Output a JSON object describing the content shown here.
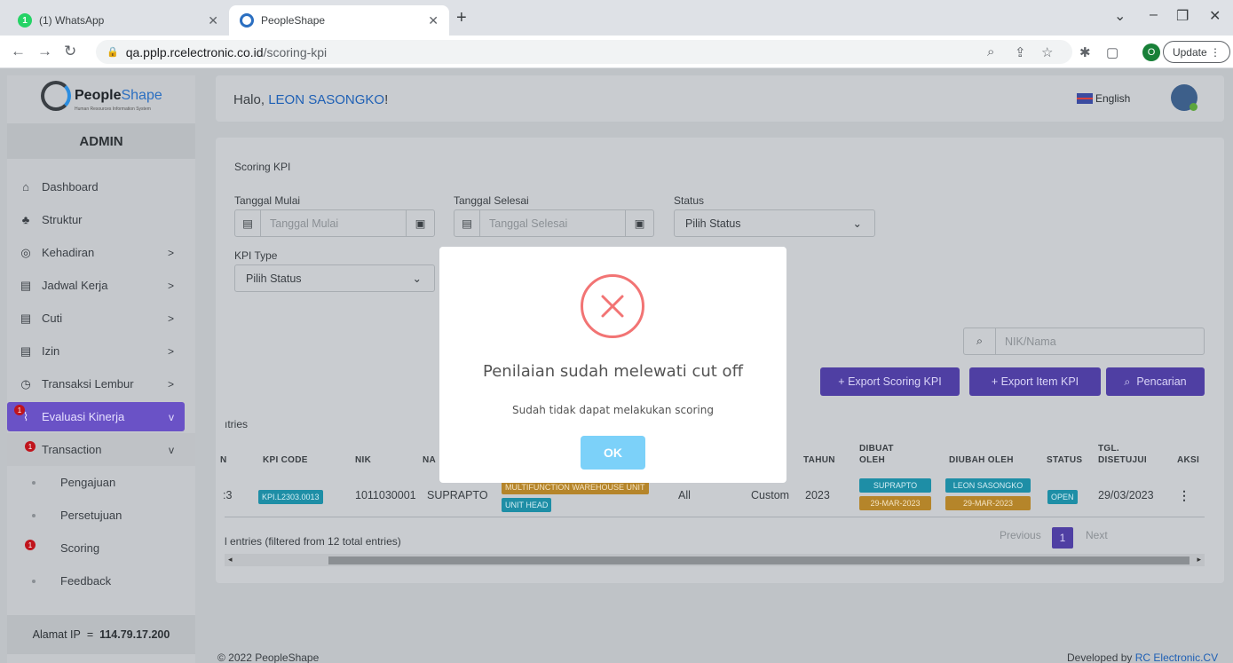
{
  "browser": {
    "tabs": [
      {
        "label": "(1) WhatsApp",
        "favicon_badge": "1"
      },
      {
        "label": "PeopleShape"
      }
    ],
    "new_tab": "+",
    "url_host": "qa.pplp.rcelectronic.co.id",
    "url_path": "/scoring-kpi",
    "profile_initial": "O",
    "update_label": "Update"
  },
  "sidebar": {
    "logo_word_a": "People",
    "logo_word_b": "Shape",
    "logo_sub": "Human Resources Information System",
    "role": "ADMIN",
    "items": [
      {
        "label": "Dashboard",
        "icon": "home-icon"
      },
      {
        "label": "Struktur",
        "icon": "org-chart-icon"
      },
      {
        "label": "Kehadiran",
        "icon": "fingerprint-icon",
        "arrow": ">"
      },
      {
        "label": "Jadwal Kerja",
        "icon": "calendar-icon",
        "arrow": ">"
      },
      {
        "label": "Cuti",
        "icon": "calendar-icon",
        "arrow": ">"
      },
      {
        "label": "Izin",
        "icon": "calendar-icon",
        "arrow": ">"
      },
      {
        "label": "Transaksi Lembur",
        "icon": "clock-icon",
        "arrow": ">"
      },
      {
        "label": "Evaluasi Kinerja",
        "icon": "chart-icon",
        "arrow": "v",
        "badge": "1"
      },
      {
        "label": "Transaction",
        "arrow": "v",
        "badge": "1"
      },
      {
        "label": "Pengajuan"
      },
      {
        "label": "Persetujuan"
      },
      {
        "label": "Scoring",
        "badge": "1"
      },
      {
        "label": "Feedback"
      }
    ],
    "ip_label": "Alamat IP",
    "ip_sep": "=",
    "ip_value": "114.79.17.200"
  },
  "header": {
    "greeting": "Halo,",
    "user": "LEON SASONGKO",
    "exclaim": "!",
    "language": "English"
  },
  "main": {
    "title": "Scoring KPI",
    "tanggal_mulai_label": "Tanggal Mulai",
    "tanggal_mulai_placeholder": "Tanggal Mulai",
    "tanggal_selesai_label": "Tanggal Selesai",
    "tanggal_selesai_placeholder": "Tanggal Selesai",
    "status_label": "Status",
    "status_value": "Pilih Status",
    "kpi_type_label": "KPI Type",
    "kpi_type_value": "Pilih Status",
    "search_placeholder": "NIK/Nama",
    "export_scoring": "+ Export Scoring KPI",
    "export_item": "+ Export Item KPI",
    "pencarian": "Pencarian",
    "entries_top": "ıtries",
    "table": {
      "headers": [
        "N",
        "KPI CODE",
        "NIK",
        "NA",
        "TAHUN",
        "DIBUAT",
        "OLEH",
        "DIUBAH OLEH",
        "STATUS",
        "TGL.",
        "DISETUJUI",
        "AKSI"
      ],
      "row": {
        "no": ":3",
        "kpi_code": "KPI.L2303.0013",
        "nik": "1011030001",
        "nama": "SUPRAPTO",
        "unit": "MULTIFUNCTION WAREHOUSE UNIT",
        "jabatan": "UNIT HEAD",
        "scope": "All",
        "type": "Custom",
        "tahun": "2023",
        "dibuat_oleh": "SUPRAPTO",
        "dibuat_tgl": "29-MAR-2023",
        "diubah_oleh": "LEON SASONGKO",
        "diubah_tgl": "29-MAR-2023",
        "status": "OPEN",
        "tgl_disetujui": "29/03/2023",
        "aksi": "⋮"
      }
    },
    "entries_info": "l entries (filtered from 12 total entries)",
    "pagination": {
      "previous": "Previous",
      "page": "1",
      "next": "Next"
    }
  },
  "footer": {
    "copyright": "© 2022 PeopleShape",
    "developed_by": "Developed by",
    "developer": "RC Electronic.CV"
  },
  "modal": {
    "title": "Penilaian sudah melewati cut off",
    "text": "Sudah tidak dapat melakukan scoring",
    "ok": "OK",
    "icon": "error-x-icon",
    "error_color": "#f27474",
    "ok_color": "#7cd1f9"
  }
}
